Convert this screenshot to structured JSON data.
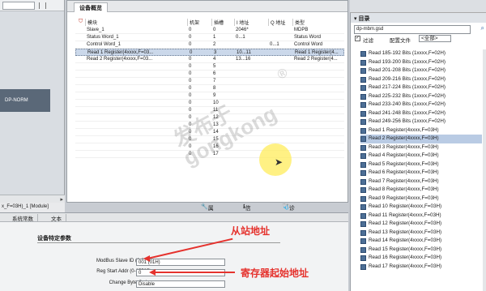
{
  "overview": {
    "tab_label": "设备概览",
    "columns": [
      "模块",
      "机架",
      "插槽",
      "I 地址",
      "Q 地址",
      "类型"
    ],
    "rows": [
      {
        "module": "Slave_1",
        "rack": "0",
        "slot": "0",
        "i": "2046*",
        "q": "",
        "type": "MDPB"
      },
      {
        "module": "Status Word_1",
        "rack": "0",
        "slot": "1",
        "i": "0...1",
        "q": "",
        "type": "Status Word"
      },
      {
        "module": "Control Word_1",
        "rack": "0",
        "slot": "2",
        "i": "",
        "q": "0...1",
        "type": "Control Word"
      },
      {
        "module": "Read 1 Register(4xxxx,F=03...",
        "rack": "0",
        "slot": "3",
        "i": "10...11",
        "q": "",
        "type": "Read 1 Register(4..."
      },
      {
        "module": "Read 2 Register(4xxxx,F=03...",
        "rack": "0",
        "slot": "4",
        "i": "13...16",
        "q": "",
        "type": "Read 2 Register(4..."
      },
      {
        "module": "",
        "rack": "0",
        "slot": "5",
        "i": "",
        "q": "",
        "type": ""
      },
      {
        "module": "",
        "rack": "0",
        "slot": "6",
        "i": "",
        "q": "",
        "type": ""
      },
      {
        "module": "",
        "rack": "0",
        "slot": "7",
        "i": "",
        "q": "",
        "type": ""
      },
      {
        "module": "",
        "rack": "0",
        "slot": "8",
        "i": "",
        "q": "",
        "type": ""
      },
      {
        "module": "",
        "rack": "0",
        "slot": "9",
        "i": "",
        "q": "",
        "type": ""
      },
      {
        "module": "",
        "rack": "0",
        "slot": "10",
        "i": "",
        "q": "",
        "type": ""
      },
      {
        "module": "",
        "rack": "0",
        "slot": "11",
        "i": "",
        "q": "",
        "type": ""
      },
      {
        "module": "",
        "rack": "0",
        "slot": "12",
        "i": "",
        "q": "",
        "type": ""
      },
      {
        "module": "",
        "rack": "0",
        "slot": "13",
        "i": "",
        "q": "",
        "type": ""
      },
      {
        "module": "",
        "rack": "0",
        "slot": "14",
        "i": "",
        "q": "",
        "type": ""
      },
      {
        "module": "",
        "rack": "0",
        "slot": "15",
        "i": "",
        "q": "",
        "type": ""
      },
      {
        "module": "",
        "rack": "0",
        "slot": "16",
        "i": "",
        "q": "",
        "type": ""
      },
      {
        "module": "",
        "rack": "0",
        "slot": "17",
        "i": "",
        "q": "",
        "type": ""
      }
    ],
    "selected_index": 3
  },
  "left": {
    "device_label": "DP-NORM",
    "module_label": "x_F=03H)_1 [Module]"
  },
  "prop_tabs": {
    "properties": "属性",
    "info": "信息",
    "diagnostics": "诊断"
  },
  "bottom": {
    "tabs": [
      "",
      "系统常数",
      "文本"
    ],
    "params_title": "设备特定参数",
    "params": [
      {
        "label": "ModBus Slave ID (0-255):",
        "value": "001 (01H)"
      },
      {
        "label": "Reg Start Addr (0-65535):",
        "value": "0"
      },
      {
        "label": "Change Byte Order:",
        "value": "Disable"
      }
    ]
  },
  "annotations": {
    "slave_addr": "从站地址",
    "reg_start": "寄存器起始地址"
  },
  "watermark": {
    "line1": "发布于",
    "line2": "gongkong",
    "reg": "®"
  },
  "catalog": {
    "title": "目录",
    "search_value": "dp-mbm.gsd",
    "filter_label": "过滤",
    "profile_label": "配置文件",
    "profile_value": "<全部>",
    "items": [
      "Read 185-192 Bits (1xxxx,F=02H)",
      "Read 193-200 Bits (1xxxx,F=02H)",
      "Read 201-208 Bits (1xxxx,F=02H)",
      "Read 209-216 Bits (1xxxx,F=02H)",
      "Read 217-224 Bits (1xxxx,F=02H)",
      "Read 225-232 Bits (1xxxx,F=02H)",
      "Read 233-240 Bits (1xxxx,F=02H)",
      "Read 241-248 Bits (1xxxx,F=02H)",
      "Read 249-256 Bits (1xxxx,F=02H)",
      "Read 1 Register(4xxxx,F=03H)",
      "Read 2 Register(4xxxx,F=03H)",
      "Read 3 Register(4xxxx,F=03H)",
      "Read 4 Register(4xxxx,F=03H)",
      "Read 5 Register(4xxxx,F=03H)",
      "Read 6 Register(4xxxx,F=03H)",
      "Read 7 Register(4xxxx,F=03H)",
      "Read 8 Register(4xxxx,F=03H)",
      "Read 9 Register(4xxxx,F=03H)",
      "Read 10 Register(4xxxx,F=03H)",
      "Read 11 Register(4xxxx,F=03H)",
      "Read 12 Register(4xxxx,F=03H)",
      "Read 13 Register(4xxxx,F=03H)",
      "Read 14 Register(4xxxx,F=03H)",
      "Read 15 Register(4xxxx,F=03H)",
      "Read 16 Register(4xxxx,F=03H)",
      "Read 17 Register(4xxxx,F=03H)"
    ],
    "highlight_index": 10
  },
  "colors": {
    "annotation_red": "#e5322d",
    "selection_blue": "#cbd8ea"
  }
}
